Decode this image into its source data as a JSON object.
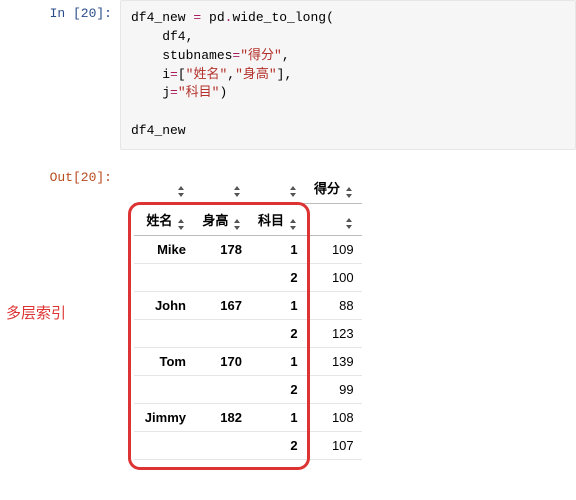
{
  "in_prompt": "In [20]:",
  "out_prompt": "Out[20]:",
  "code": {
    "line1_a": "df4_new ",
    "line1_op": "=",
    "line1_b": " pd",
    "line1_dot": ".",
    "line1_fn": "wide_to_long",
    "line1_op2": "(",
    "line2": "    df4",
    "line2_c": ",",
    "line3_a": "    stubnames",
    "line3_eq": "=",
    "line3_s": "\"得分\"",
    "line3_c": ",",
    "line4_a": "    i",
    "line4_eq": "=",
    "line4_b1": "[",
    "line4_s1": "\"姓名\"",
    "line4_cm": ",",
    "line4_s2": "\"身高\"",
    "line4_b2": "]",
    "line4_c": ",",
    "line5_a": "    j",
    "line5_eq": "=",
    "line5_s": "\"科目\"",
    "line5_p": ")",
    "blank": "",
    "line7": "df4_new"
  },
  "columns": {
    "value": "得分"
  },
  "index_names": {
    "n0": "姓名",
    "n1": "身高",
    "n2": "科目"
  },
  "rows": [
    {
      "name": "Mike",
      "height": "178",
      "subj": "1",
      "score": "109"
    },
    {
      "name": "",
      "height": "",
      "subj": "2",
      "score": "100"
    },
    {
      "name": "John",
      "height": "167",
      "subj": "1",
      "score": "88"
    },
    {
      "name": "",
      "height": "",
      "subj": "2",
      "score": "123"
    },
    {
      "name": "Tom",
      "height": "170",
      "subj": "1",
      "score": "139"
    },
    {
      "name": "",
      "height": "",
      "subj": "2",
      "score": "99"
    },
    {
      "name": "Jimmy",
      "height": "182",
      "subj": "1",
      "score": "108"
    },
    {
      "name": "",
      "height": "",
      "subj": "2",
      "score": "107"
    }
  ],
  "annotation": "多层索引"
}
